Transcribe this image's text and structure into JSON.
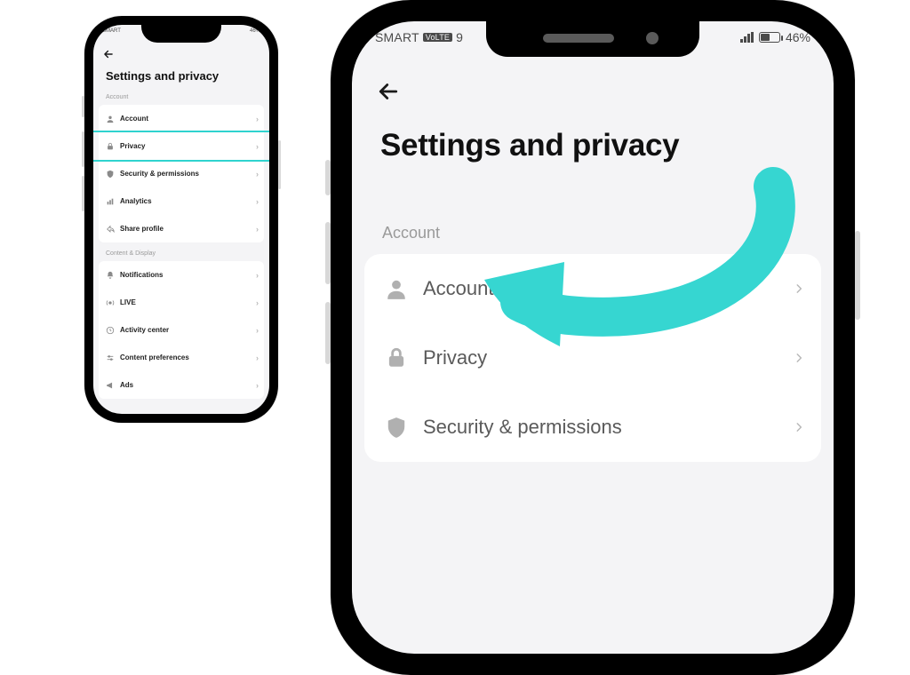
{
  "status": {
    "carrier": "SMART",
    "network_extra": "9",
    "battery_text": "46%"
  },
  "header": {
    "title": "Settings and privacy"
  },
  "sections": {
    "account_label": "Account",
    "content_label": "Content & Display"
  },
  "rows_account": [
    {
      "icon": "person-icon",
      "label": "Account"
    },
    {
      "icon": "lock-icon",
      "label": "Privacy"
    },
    {
      "icon": "shield-icon",
      "label": "Security & permissions"
    },
    {
      "icon": "chart-icon",
      "label": "Analytics"
    },
    {
      "icon": "share-icon",
      "label": "Share profile"
    }
  ],
  "rows_content": [
    {
      "icon": "bell-icon",
      "label": "Notifications"
    },
    {
      "icon": "live-icon",
      "label": "LIVE"
    },
    {
      "icon": "clock-icon",
      "label": "Activity center"
    },
    {
      "icon": "sliders-icon",
      "label": "Content preferences"
    },
    {
      "icon": "megaphone-icon",
      "label": "Ads"
    }
  ],
  "big_rows": [
    {
      "icon": "person-icon",
      "label": "Account"
    },
    {
      "icon": "lock-icon",
      "label": "Privacy"
    },
    {
      "icon": "shield-icon",
      "label": "Security & permissions"
    }
  ],
  "annotation": {
    "highlight_row": "Privacy",
    "arrow_color": "#36d6d1"
  }
}
